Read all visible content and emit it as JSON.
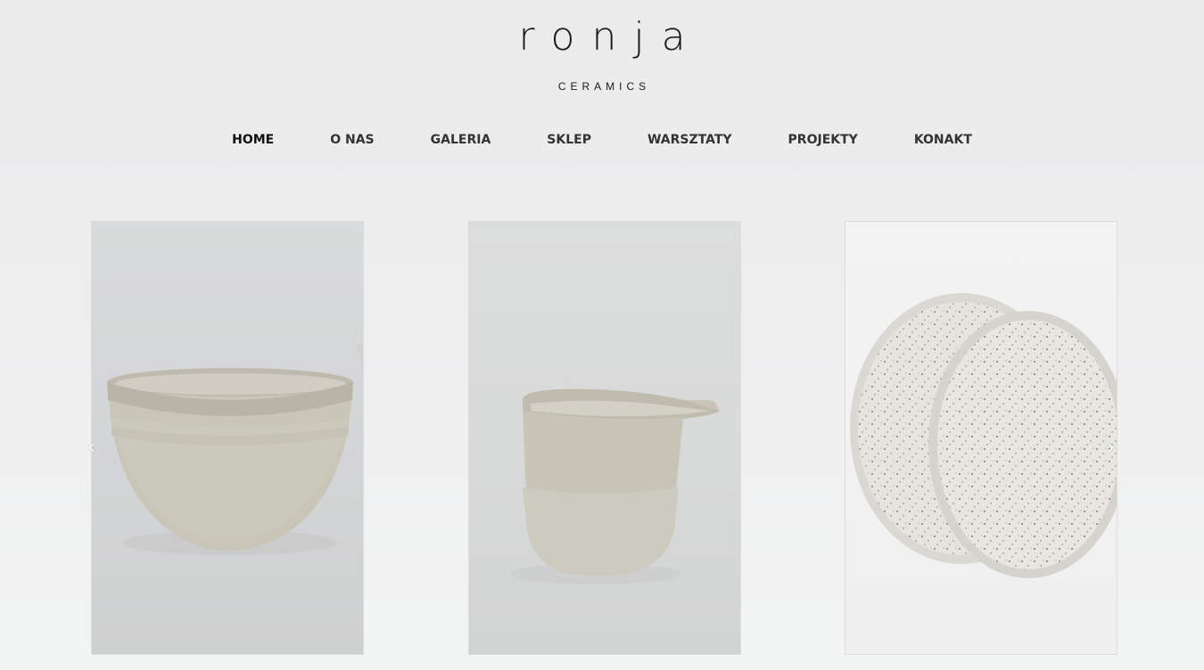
{
  "brand": {
    "logo_word": "ronja",
    "logo_sub": "CERAMICS"
  },
  "nav": {
    "items": [
      {
        "label": "HOME",
        "active": true
      },
      {
        "label": "O NAS"
      },
      {
        "label": "GALERIA"
      },
      {
        "label": "SKLEP"
      },
      {
        "label": "WARSZTATY"
      },
      {
        "label": "PROJEKTY"
      },
      {
        "label": "KONAKT"
      }
    ]
  },
  "slider": {
    "prev_glyph": "‹",
    "next_glyph": "›",
    "slides": [
      {
        "subject": "ceramic-bowl"
      },
      {
        "subject": "ceramic-pitcher-cup"
      },
      {
        "subject": "speckled-plates"
      }
    ]
  },
  "colors": {
    "background": "#eeeeef",
    "text": "#1a1a1a",
    "nav_text": "#333333"
  }
}
